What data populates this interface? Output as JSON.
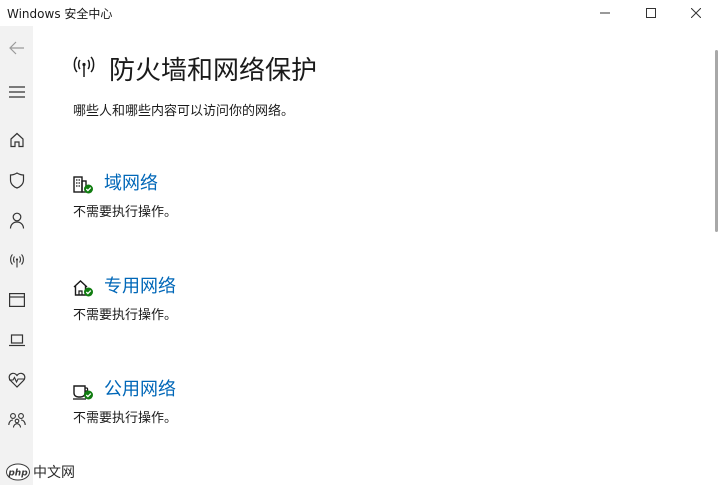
{
  "window": {
    "title": "Windows 安全中心"
  },
  "rail": {
    "items": [
      {
        "icon": "back-arrow-icon"
      },
      {
        "icon": "hamburger-menu-icon"
      },
      {
        "icon": "home-icon"
      },
      {
        "icon": "shield-icon"
      },
      {
        "icon": "person-icon"
      },
      {
        "icon": "antenna-icon"
      },
      {
        "icon": "app-browser-icon"
      },
      {
        "icon": "laptop-icon"
      },
      {
        "icon": "heart-pulse-icon"
      },
      {
        "icon": "family-icon"
      },
      {
        "icon": "gear-icon"
      }
    ]
  },
  "page": {
    "icon": "antenna-icon",
    "title": "防火墙和网络保护",
    "subtitle": "哪些人和哪些内容可以访问你的网络。"
  },
  "networks": [
    {
      "label": "域网络",
      "status": "不需要执行操作。",
      "icon": "domain-network-icon"
    },
    {
      "label": "专用网络",
      "status": "不需要执行操作。",
      "icon": "private-network-icon"
    },
    {
      "label": "公用网络",
      "status": "不需要执行操作。",
      "icon": "public-network-icon"
    }
  ],
  "colors": {
    "link": "#0067b8",
    "check": "#107c10",
    "rail": "#f2f2f2"
  },
  "watermark": {
    "text": "中文网"
  }
}
